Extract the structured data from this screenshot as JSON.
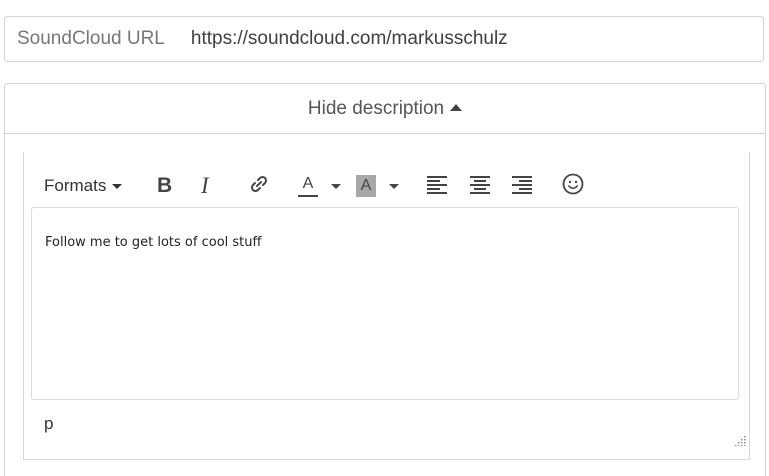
{
  "soundcloud": {
    "label": "SoundCloud URL",
    "value": "https://soundcloud.com/markusschulz"
  },
  "description_toggle": {
    "label": "Hide description"
  },
  "editor": {
    "toolbar": {
      "formats_label": "Formats",
      "bold_glyph": "B",
      "italic_glyph": "I",
      "text_color_glyph": "A",
      "bg_color_glyph": "A"
    },
    "content": "Follow me to get lots of cool stuff",
    "statusbar_path": "p"
  }
}
